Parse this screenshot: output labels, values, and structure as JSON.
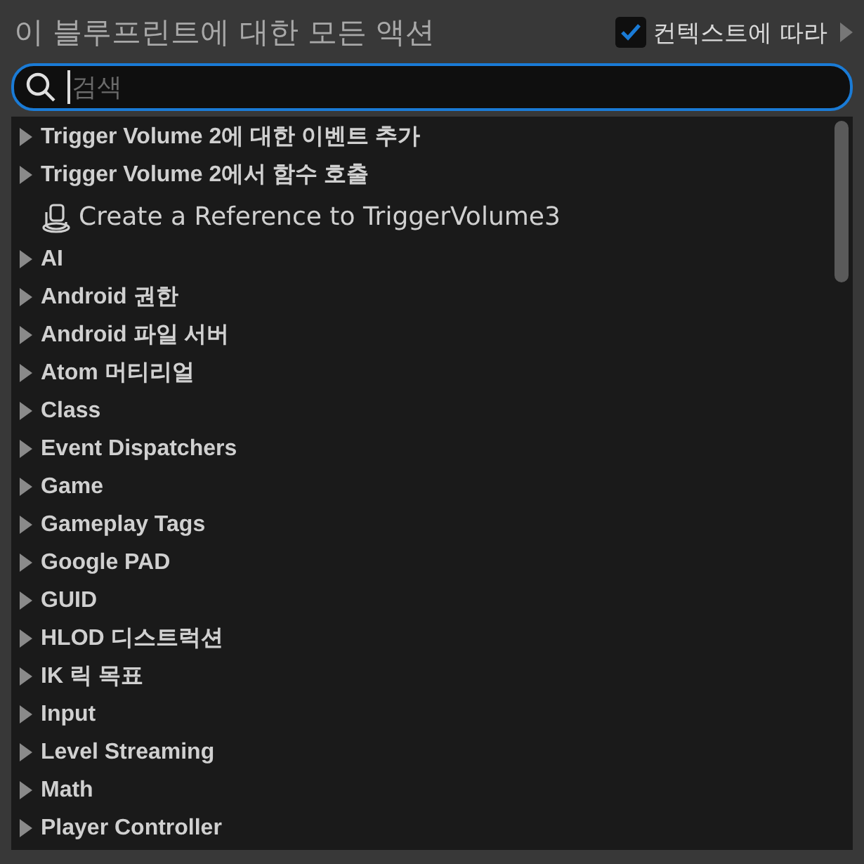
{
  "header": {
    "title": "이 블루프린트에 대한 모든 액션",
    "context_toggle": {
      "label": "컨텍스트에 따라",
      "checked": true
    }
  },
  "search": {
    "placeholder": "검색"
  },
  "items": [
    {
      "kind": "category",
      "label": "Trigger Volume 2에 대한 이벤트 추가"
    },
    {
      "kind": "category",
      "label": "Trigger Volume 2에서 함수 호출"
    },
    {
      "kind": "action",
      "label": "Create a Reference to TriggerVolume3"
    },
    {
      "kind": "category",
      "label": "AI"
    },
    {
      "kind": "category",
      "label": "Android 권한"
    },
    {
      "kind": "category",
      "label": "Android 파일 서버"
    },
    {
      "kind": "category",
      "label": "Atom 머티리얼"
    },
    {
      "kind": "category",
      "label": "Class"
    },
    {
      "kind": "category",
      "label": "Event Dispatchers"
    },
    {
      "kind": "category",
      "label": "Game"
    },
    {
      "kind": "category",
      "label": "Gameplay Tags"
    },
    {
      "kind": "category",
      "label": "Google PAD"
    },
    {
      "kind": "category",
      "label": "GUID"
    },
    {
      "kind": "category",
      "label": "HLOD 디스트럭션"
    },
    {
      "kind": "category",
      "label": "IK 릭 목표"
    },
    {
      "kind": "category",
      "label": "Input"
    },
    {
      "kind": "category",
      "label": "Level Streaming"
    },
    {
      "kind": "category",
      "label": "Math"
    },
    {
      "kind": "category",
      "label": "Player Controller"
    }
  ]
}
